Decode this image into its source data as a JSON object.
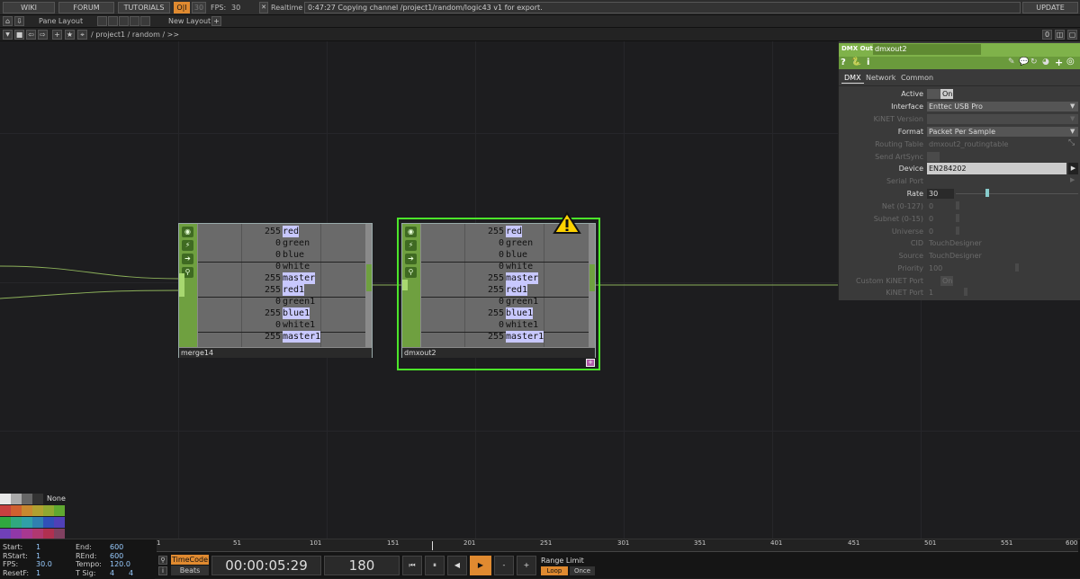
{
  "topbar": {
    "wiki": "WIKI",
    "forum": "FORUM",
    "tutorials": "TUTORIALS",
    "fps_label": "FPS:",
    "fps_value": "30",
    "fps_toggle": "30",
    "realtime_label": "Realtime",
    "status": "0:47:27 Copying channel /project1/random/logic43 v1 for export.",
    "update": "UPDATE"
  },
  "bar2": {
    "pane_layout": "Pane Layout",
    "new_layout": "New Layout",
    "plus": "+"
  },
  "path": {
    "text": "/ project1 / random / >>",
    "zero": "0"
  },
  "colors": {
    "node_green": "#6fa040",
    "panel_bg": "#3a3a3a",
    "panel_header": "#7fb24a",
    "highlight": "#c8c8ff",
    "warning": "#ffd200",
    "accent": "#e08a30"
  },
  "merge14": {
    "name": "merge14",
    "rows": [
      {
        "v": "255",
        "n": "red"
      },
      {
        "v": "0",
        "n": "green"
      },
      {
        "v": "0",
        "n": "blue"
      },
      {
        "v": "0",
        "n": "white"
      },
      {
        "v": "255",
        "n": "master"
      },
      {
        "v": "255",
        "n": "red1"
      },
      {
        "v": "0",
        "n": "green1"
      },
      {
        "v": "255",
        "n": "blue1"
      },
      {
        "v": "0",
        "n": "white1"
      },
      {
        "v": "255",
        "n": "master1"
      }
    ]
  },
  "dmxout2": {
    "name": "dmxout2",
    "rows": [
      {
        "v": "255",
        "n": "red"
      },
      {
        "v": "0",
        "n": "green"
      },
      {
        "v": "0",
        "n": "blue"
      },
      {
        "v": "0",
        "n": "white"
      },
      {
        "v": "255",
        "n": "master"
      },
      {
        "v": "255",
        "n": "red1"
      },
      {
        "v": "0",
        "n": "green1"
      },
      {
        "v": "255",
        "n": "blue1"
      },
      {
        "v": "0",
        "n": "white1"
      },
      {
        "v": "255",
        "n": "master1"
      }
    ]
  },
  "panel": {
    "type": "DMX Out",
    "name": "dmxout2",
    "tabs": [
      "DMX",
      "Network",
      "Common"
    ],
    "params": [
      {
        "label": "Active",
        "value": "On",
        "dis": false
      },
      {
        "label": "Interface",
        "value": "Enttec USB Pro",
        "dis": false
      },
      {
        "label": "KiNET Version",
        "value": "",
        "dis": true
      },
      {
        "label": "Format",
        "value": "Packet Per Sample",
        "dis": false
      },
      {
        "label": "Routing Table",
        "value": "dmxout2_routingtable",
        "dis": true
      },
      {
        "label": "Send ArtSync",
        "value": "",
        "dis": true
      },
      {
        "label": "Device",
        "value": "EN284202",
        "dis": false
      },
      {
        "label": "Serial Port",
        "value": "",
        "dis": true
      },
      {
        "label": "Rate",
        "value": "30",
        "dis": false
      },
      {
        "label": "Net (0-127)",
        "value": "0",
        "dis": true
      },
      {
        "label": "Subnet (0-15)",
        "value": "0",
        "dis": true
      },
      {
        "label": "Universe",
        "value": "0",
        "dis": true
      },
      {
        "label": "CID",
        "value": "TouchDesigner",
        "dis": true
      },
      {
        "label": "Source",
        "value": "TouchDesigner",
        "dis": true
      },
      {
        "label": "Priority",
        "value": "100",
        "dis": true
      },
      {
        "label": "Custom KiNET Port",
        "value": "On",
        "dis": true
      },
      {
        "label": "KiNET Port",
        "value": "1",
        "dis": true
      }
    ]
  },
  "palette": {
    "none": "None"
  },
  "bottom": {
    "start_l": "Start:",
    "start_v": "1",
    "end_l": "End:",
    "end_v": "600",
    "rstart_l": "RStart:",
    "rstart_v": "1",
    "rend_l": "REnd:",
    "rend_v": "600",
    "fps_l": "FPS:",
    "fps_v": "30.0",
    "tempo_l": "Tempo:",
    "tempo_v": "120.0",
    "resetf_l": "ResetF:",
    "resetf_v": "1",
    "tsig_l": "T Sig:",
    "tsig_v1": "4",
    "tsig_v2": "4",
    "timecode": "TimeCode",
    "beats": "Beats",
    "time": "00:00:05:29",
    "frame": "180",
    "range_limit": "Range Limit",
    "loop": "Loop",
    "once": "Once",
    "minus": "-",
    "plus": "+",
    "ticks": [
      "1",
      "51",
      "101",
      "151",
      "201",
      "251",
      "301",
      "351",
      "401",
      "451",
      "501",
      "551",
      "600"
    ]
  }
}
